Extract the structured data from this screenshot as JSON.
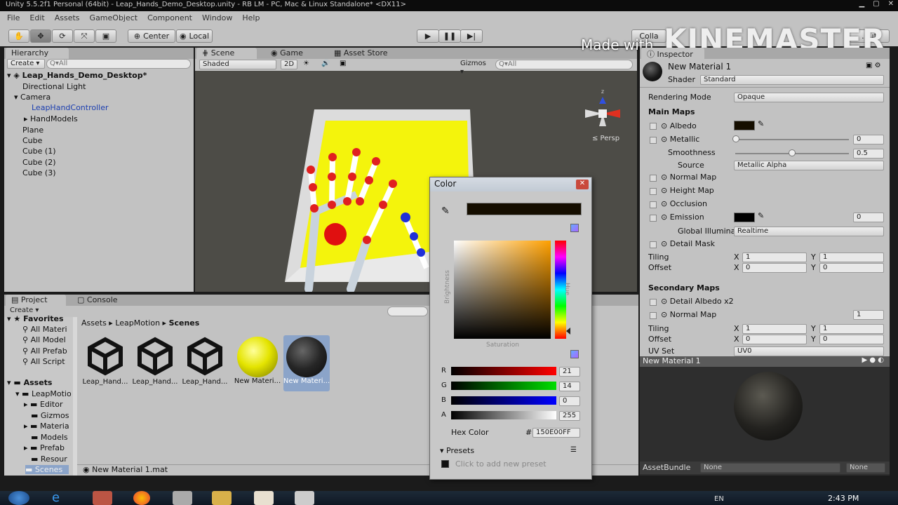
{
  "window": {
    "title": "Unity 5.5.2f1 Personal (64bit) - Leap_Hands_Demo_Desktop.unity - RB LM - PC, Mac & Linux Standalone* <DX11>"
  },
  "menu": [
    "File",
    "Edit",
    "Assets",
    "GameObject",
    "Component",
    "Window",
    "Help"
  ],
  "toolbar": {
    "center": "Center",
    "local": "Local",
    "collab": "Colla",
    "layers": "...",
    "layout": "...ut"
  },
  "watermark": {
    "made_with": "Made with",
    "brand": "KINEMASTER"
  },
  "hierarchy": {
    "tab": "Hierarchy",
    "create": "Create ▾",
    "search_placeholder": "Q▾All",
    "scene": "Leap_Hands_Demo_Desktop*",
    "items": [
      "Directional Light",
      "Camera",
      "LeapHandController",
      "HandModels",
      "Plane",
      "Cube",
      "Cube (1)",
      "Cube (2)",
      "Cube (3)"
    ]
  },
  "scene_tabs": {
    "scene": "Scene",
    "game": "Game",
    "store": "Asset Store"
  },
  "scene_toolbar": {
    "shaded": "Shaded",
    "twod": "2D",
    "gizmos": "Gizmos ▾",
    "search": "Q▾All",
    "persp": "≤ Persp"
  },
  "project": {
    "tab": "Project",
    "console": "Console",
    "create": "Create ▾",
    "tree": [
      "Favorites",
      "All Materi",
      "All Model",
      "All Prefab",
      "All Script",
      "Assets",
      "LeapMotio",
      "Editor",
      "Gizmos",
      "Materia",
      "Models",
      "Prefab",
      "Resour",
      "Scenes"
    ],
    "breadcrumb": [
      "Assets",
      "LeapMotion",
      "Scenes"
    ],
    "assets": [
      "Leap_Hand...",
      "Leap_Hand...",
      "Leap_Hand...",
      "New Materi...",
      "New Materi..."
    ],
    "status": "New Material 1.mat"
  },
  "color_picker": {
    "title": "Color",
    "brightness": "Brightness",
    "saturation": "Saturation",
    "hue": "Hue",
    "channels": [
      {
        "label": "R",
        "value": "21"
      },
      {
        "label": "G",
        "value": "14"
      },
      {
        "label": "B",
        "value": "0"
      },
      {
        "label": "A",
        "value": "255"
      }
    ],
    "hex_label": "Hex Color",
    "hex_hash": "#",
    "hex_value": "150E00FF",
    "presets": "Presets",
    "add_preset": "Click to add new preset",
    "current_color": "#150e00"
  },
  "inspector": {
    "tab": "Inspector",
    "material_name": "New Material 1",
    "shader_label": "Shader",
    "shader_value": "Standard",
    "rendering_mode_label": "Rendering Mode",
    "rendering_mode_value": "Opaque",
    "main_maps": "Main Maps",
    "albedo": "Albedo",
    "metallic": "Metallic",
    "metallic_value": "0",
    "smoothness": "Smoothness",
    "smoothness_value": "0.5",
    "smoothness_level": 0.5,
    "source": "Source",
    "source_value": "Metallic Alpha",
    "normal_map": "Normal Map",
    "height_map": "Height Map",
    "occlusion": "Occlusion",
    "emission": "Emission",
    "emission_value": "0",
    "gi_label": "Global Illumina",
    "gi_value": "Realtime",
    "detail_mask": "Detail Mask",
    "tiling": "Tiling",
    "offset": "Offset",
    "x": "X",
    "y": "Y",
    "tiling_x": "1",
    "tiling_y": "1",
    "offset_x": "0",
    "offset_y": "0",
    "secondary_maps": "Secondary Maps",
    "detail_albedo": "Detail Albedo x2",
    "secondary_normal": "Normal Map",
    "secondary_normal_value": "1",
    "uv_set": "UV Set",
    "uv_set_value": "UV0",
    "preview_title": "New Material 1",
    "assetbundle": "AssetBundle",
    "assetbundle_value": "None",
    "assetbundle_variant": "None"
  },
  "taskbar": {
    "lang": "EN",
    "clock": "2:43 PM"
  }
}
